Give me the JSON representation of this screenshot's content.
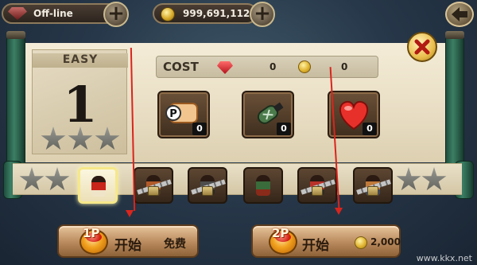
{
  "hud": {
    "status_label": "Off-line",
    "coin_balance": "999,691,112",
    "status_icon": "red-gem-icon",
    "coin_icon": "coin-icon"
  },
  "colors": {
    "scroll_pole": "#2a5f4a",
    "paper": "#ece2c8",
    "item_slot": "#4f3a28",
    "button_wood": "#c59666",
    "guide_arrow": "#d9251d"
  },
  "difficulty": {
    "label": "EASY",
    "level": "1",
    "stars_total": 3,
    "stars_earned": 0
  },
  "cost": {
    "label": "COST",
    "gem_amount": "0",
    "coin_amount": "0"
  },
  "items": [
    {
      "name": "powerup-scroll",
      "icon": "p-scroll-icon",
      "count": "0"
    },
    {
      "name": "bomb",
      "icon": "bomb-icon",
      "count": "0"
    },
    {
      "name": "heart",
      "icon": "heart-icon",
      "count": "0"
    }
  ],
  "characters": [
    {
      "name": "fighter-red",
      "locked": false,
      "selected": true
    },
    {
      "name": "fighter-2",
      "locked": true,
      "selected": false
    },
    {
      "name": "fighter-3",
      "locked": true,
      "selected": false
    },
    {
      "name": "fighter-4",
      "locked": false,
      "selected": false
    },
    {
      "name": "fighter-5",
      "locked": true,
      "selected": false
    },
    {
      "name": "fighter-6",
      "locked": true,
      "selected": false
    }
  ],
  "buttons": {
    "start_1p": {
      "player": "1P",
      "label": "开始",
      "fee": "免费"
    },
    "start_2p": {
      "player": "2P",
      "label": "开始",
      "price": "2,000"
    }
  },
  "watermark": "www.kkx.net"
}
